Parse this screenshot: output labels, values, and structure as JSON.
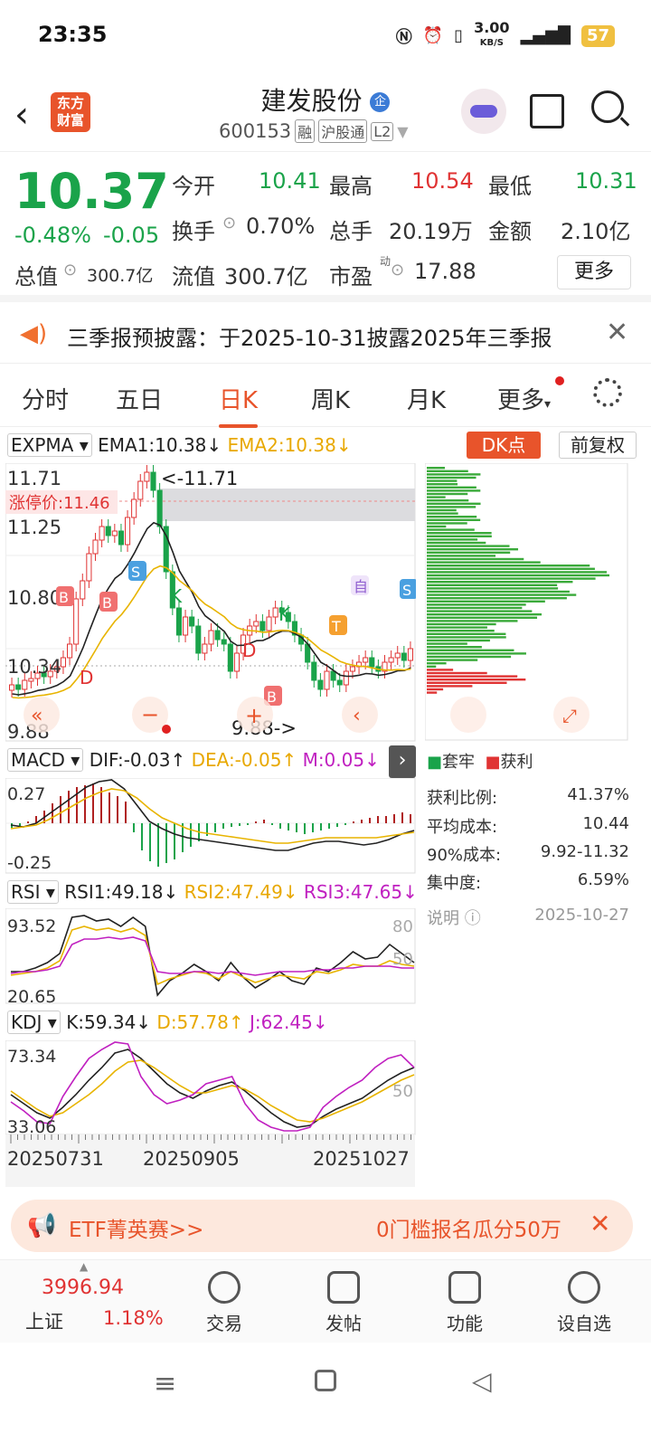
{
  "status": {
    "time": "23:35",
    "speed": "3.00",
    "speed_unit": "KB/S",
    "battery": "57"
  },
  "header": {
    "logo": "东方财富",
    "name": "建发股份",
    "qi_badge": "企",
    "code": "600153",
    "tags": [
      "融",
      "沪股通",
      "L2"
    ]
  },
  "quote": {
    "price": "10.37",
    "pct": "-0.48%",
    "chg": "-0.05",
    "open_label": "今开",
    "open": "10.41",
    "high_label": "最高",
    "high": "10.54",
    "low_label": "最低",
    "low": "10.31",
    "turnover_label": "换手",
    "turnover": "0.70%",
    "volume_label": "总手",
    "volume": "20.19万",
    "amount_label": "金额",
    "amount": "2.10亿",
    "mcap_label": "总值",
    "mcap": "300.7亿",
    "float_label": "流值",
    "float": "300.7亿",
    "pe_label": "市盈",
    "pe_sup": "动",
    "pe": "17.88",
    "more": "更多"
  },
  "notice": {
    "text": "三季报预披露：于2025-10-31披露2025年三季报"
  },
  "tabs": [
    "分时",
    "五日",
    "日K",
    "周K",
    "月K",
    "更多"
  ],
  "chart": {
    "ema_sel": "EXPMA",
    "ema1": "EMA1:10.38↓",
    "ema2": "EMA2:10.38↓",
    "dk": "DK点",
    "fq": "前复权",
    "y_top": "11.71",
    "y_limit": "11.25",
    "y_mid": "10.80",
    "y_low": "10.34",
    "y_bottom": "9.88",
    "limit_label": "涨停价:11.46",
    "high_mark": "<-11.71",
    "low_mark": "9.88->",
    "macd_sel": "MACD",
    "dif": "DIF:-0.03↑",
    "dea": "DEA:-0.05↑",
    "m": "M:0.05↓",
    "macd_top": "0.27",
    "macd_bot": "-0.25",
    "rsi_sel": "RSI",
    "rsi1": "RSI1:49.18↓",
    "rsi2": "RSI2:47.49↓",
    "rsi3": "RSI3:47.65↓",
    "rsi_top": "93.52",
    "rsi_bot": "20.65",
    "rsi_80": "80",
    "rsi_50": "50",
    "kdj_sel": "KDJ",
    "k": "K:59.34↓",
    "d": "D:57.78↑",
    "j": "J:62.45↓",
    "kdj_top": "73.34",
    "kdj_bot": "33.06",
    "kdj_50": "50",
    "dates": [
      "20250731",
      "20250905",
      "20251027"
    ],
    "markers": [
      "B",
      "B",
      "S",
      "K",
      "D",
      "K",
      "D",
      "B",
      "T",
      "自",
      "S"
    ]
  },
  "chip": {
    "legend_trap": "套牢",
    "legend_profit": "获利",
    "rows": [
      {
        "k": "获利比例:",
        "v": "41.37%"
      },
      {
        "k": "平均成本:",
        "v": "10.44"
      },
      {
        "k": "90%成本:",
        "v": "9.92-11.32"
      },
      {
        "k": "集中度:",
        "v": "6.59%"
      }
    ],
    "note": "说明",
    "date": "2025-10-27"
  },
  "promo": {
    "left": "ETF菁英赛>>",
    "right": "0门槛报名瓜分50万"
  },
  "bottom": {
    "index_value": "3996.94",
    "index_name": "上证",
    "index_pct": "1.18%",
    "items": [
      "交易",
      "发帖",
      "功能",
      "设自选"
    ]
  },
  "colors": {
    "up": "#e03333",
    "down": "#1aa34a",
    "accent": "#e8542b"
  }
}
